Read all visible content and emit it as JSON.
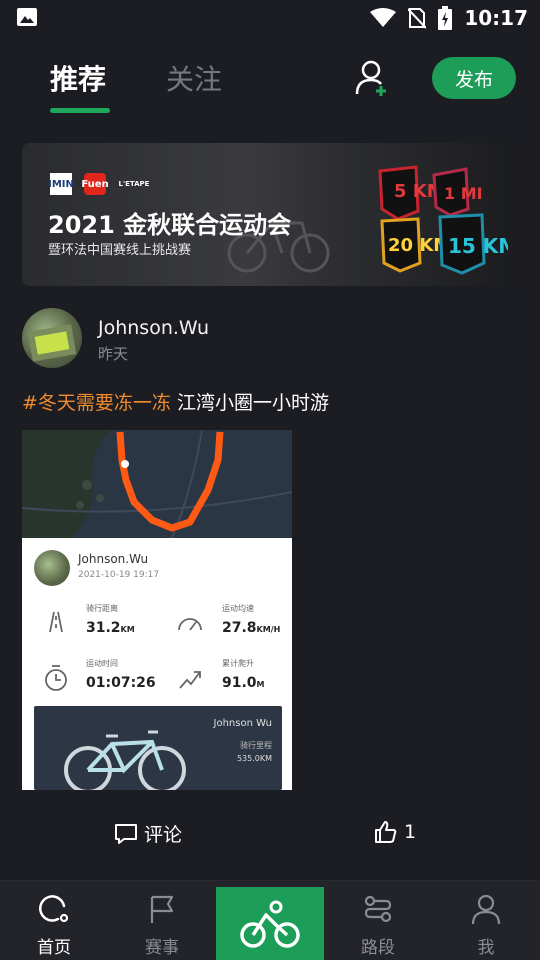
{
  "status_bar": {
    "time": "10:17",
    "icons": [
      "image-icon",
      "wifi-icon",
      "no-sim-icon",
      "battery-charging-icon"
    ]
  },
  "header": {
    "tabs": [
      {
        "label": "推荐",
        "active": true
      },
      {
        "label": "关注",
        "active": false
      }
    ],
    "add_user_icon": "add-user-icon",
    "publish_label": "发布"
  },
  "colors": {
    "accent": "#1c9d58",
    "hashtag": "#f08c2e",
    "background": "#1c1d22"
  },
  "banner": {
    "logos": [
      "IMIN",
      "Fuen",
      "L'ETAPE"
    ],
    "title": "2021 金秋联合运动会",
    "subtitle": "暨环法中国赛线上挑战赛",
    "badges": [
      "5 KM",
      "1 MI",
      "20 KM",
      "15 KM"
    ]
  },
  "post": {
    "username": "Johnson.Wu",
    "time": "昨天",
    "hashtag": "#冬天需要冻一冻",
    "text": " 江湾小圈一小时游",
    "card": {
      "username": "Johnson.Wu",
      "datetime": "2021-10-19 19:17",
      "stats": [
        {
          "label": "骑行距离",
          "value": "31.2",
          "unit": "KM"
        },
        {
          "label": "运动均速",
          "value": "27.8",
          "unit": "KM/H"
        },
        {
          "label": "运动时间",
          "value": "01:07:26",
          "unit": ""
        },
        {
          "label": "累计爬升",
          "value": "91.0",
          "unit": "M"
        }
      ],
      "bike": {
        "owner": "Johnson Wu",
        "label": "骑行里程",
        "mileage": "535.0KM"
      }
    },
    "actions": {
      "comment_label": "评论",
      "like_count": "1"
    }
  },
  "bottom_nav": {
    "items": [
      {
        "label": "首页",
        "icon": "home-icon",
        "active": true
      },
      {
        "label": "赛事",
        "icon": "flag-icon",
        "active": false
      },
      {
        "label": "",
        "icon": "bike-icon",
        "active": false
      },
      {
        "label": "路段",
        "icon": "route-icon",
        "active": false
      },
      {
        "label": "我",
        "icon": "profile-icon",
        "active": false
      }
    ]
  }
}
